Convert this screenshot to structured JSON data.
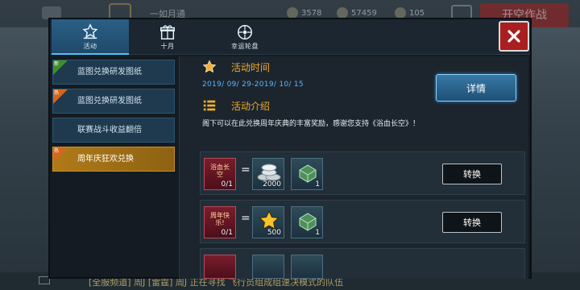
{
  "hud": {
    "player_name": "一如月通",
    "stats": [
      "3578",
      "57459",
      "105"
    ],
    "red_button": "开空作战"
  },
  "chat": {
    "text": "[全服频道] 周J [雷霆] 周J 正在寻找 飞行员组成组速决模式的队伍"
  },
  "tabs": [
    {
      "label": "活动",
      "icon": "star-badge-icon"
    },
    {
      "label": "十月",
      "icon": "gift-box-icon"
    },
    {
      "label": "幸运轮盘",
      "icon": "roulette-wheel-icon"
    }
  ],
  "sidebar": {
    "items": [
      {
        "label": "蓝图兑换研发图纸",
        "ribbon": "新",
        "ribbon_color": "#3f8f2b"
      },
      {
        "label": "蓝图兑换研发图纸",
        "ribbon": "热",
        "ribbon_color": "#d9641b"
      },
      {
        "label": "联赛战斗收益翻倍",
        "ribbon": "",
        "ribbon_color": ""
      },
      {
        "label": "周年庆狂欢兑换",
        "ribbon": "热",
        "ribbon_color": "#d9641b"
      }
    ]
  },
  "activity": {
    "time_title": "活动时间",
    "date_range": "2019/ 09/ 29-2019/ 10/ 15",
    "detail_button": "详情",
    "intro_title": "活动介绍",
    "description": "阁下可以在此兑换周年庆典的丰富奖励，感谢您支持《浴血长空》！"
  },
  "exchanges": [
    {
      "cost_item_label": "浴血长空",
      "cost_count": "0/1",
      "equals": "=",
      "reward_main_count": "2000",
      "reward_side_count": "1",
      "button": "转换"
    },
    {
      "cost_item_label": "周年快乐!",
      "cost_count": "0/1",
      "equals": "=",
      "reward_main_count": "500",
      "reward_side_count": "1",
      "button": "转换"
    }
  ]
}
